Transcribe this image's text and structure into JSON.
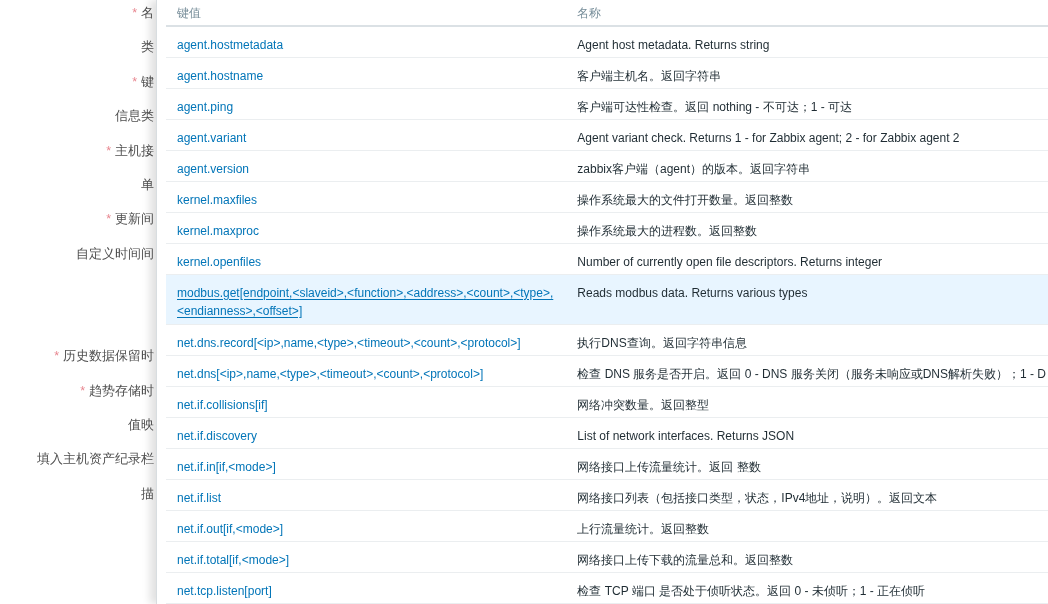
{
  "form_labels": [
    {
      "text": "名",
      "mark": "*"
    },
    {
      "text": "类"
    },
    {
      "text": "键",
      "mark": "*"
    },
    {
      "text": "信息类"
    },
    {
      "text": "主机接",
      "mark": "*"
    },
    {
      "text": "单"
    },
    {
      "text": "更新间",
      "mark": "*"
    },
    {
      "text": "自定义时间间"
    },
    {
      "text": "历史数据保留时",
      "mark": "*"
    },
    {
      "text": "趋势存储时",
      "mark": "*"
    },
    {
      "text": "值映"
    },
    {
      "text": "填入主机资产纪录栏"
    },
    {
      "text": "描"
    }
  ],
  "table": {
    "columns": [
      "键值",
      "名称"
    ],
    "rows": [
      {
        "key": "agent.hostmetadata",
        "name": "Agent host metadata. Returns string",
        "selected": false
      },
      {
        "key": "agent.hostname",
        "name": "客户端主机名。返回字符串",
        "selected": false
      },
      {
        "key": "agent.ping",
        "name": "客户端可达性检查。返回 nothing - 不可达；1 - 可达",
        "selected": false
      },
      {
        "key": "agent.variant",
        "name": "Agent variant check. Returns 1 - for Zabbix agent; 2 - for Zabbix agent 2",
        "selected": false
      },
      {
        "key": "agent.version",
        "name": "zabbix客户端（agent）的版本。返回字符串",
        "selected": false
      },
      {
        "key": "kernel.maxfiles",
        "name": "操作系统最大的文件打开数量。返回整数",
        "selected": false
      },
      {
        "key": "kernel.maxproc",
        "name": "操作系统最大的进程数。返回整数",
        "selected": false
      },
      {
        "key": "kernel.openfiles",
        "name": "Number of currently open file descriptors. Returns integer",
        "selected": false
      },
      {
        "key": "modbus.get[endpoint,<slaveid>,<function>,<address>,<count>,<type>,<endianness>,<offset>]",
        "name": "Reads modbus data. Returns various types",
        "selected": true
      },
      {
        "key": "net.dns.record[<ip>,name,<type>,<timeout>,<count>,<protocol>]",
        "name": "执行DNS查询。返回字符串信息",
        "selected": false
      },
      {
        "key": "net.dns[<ip>,name,<type>,<timeout>,<count>,<protocol>]",
        "name": "检查 DNS 服务是否开启。返回 0 - DNS 服务关闭（服务未响应或DNS解析失败）；1 - D",
        "selected": false
      },
      {
        "key": "net.if.collisions[if]",
        "name": "网络冲突数量。返回整型",
        "selected": false
      },
      {
        "key": "net.if.discovery",
        "name": "List of network interfaces. Returns JSON",
        "selected": false
      },
      {
        "key": "net.if.in[if,<mode>]",
        "name": "网络接口上传流量统计。返回 整数",
        "selected": false
      },
      {
        "key": "net.if.list",
        "name": "网络接口列表（包括接口类型，状态，IPv4地址，说明）。返回文本",
        "selected": false
      },
      {
        "key": "net.if.out[if,<mode>]",
        "name": "上行流量统计。返回整数",
        "selected": false
      },
      {
        "key": "net.if.total[if,<mode>]",
        "name": "网络接口上传下载的流量总和。返回整数",
        "selected": false
      },
      {
        "key": "net.tcp.listen[port]",
        "name": "检查 TCP 端口 是否处于侦听状态。返回 0 - 未侦听；1 - 正在侦听",
        "selected": false
      }
    ]
  }
}
